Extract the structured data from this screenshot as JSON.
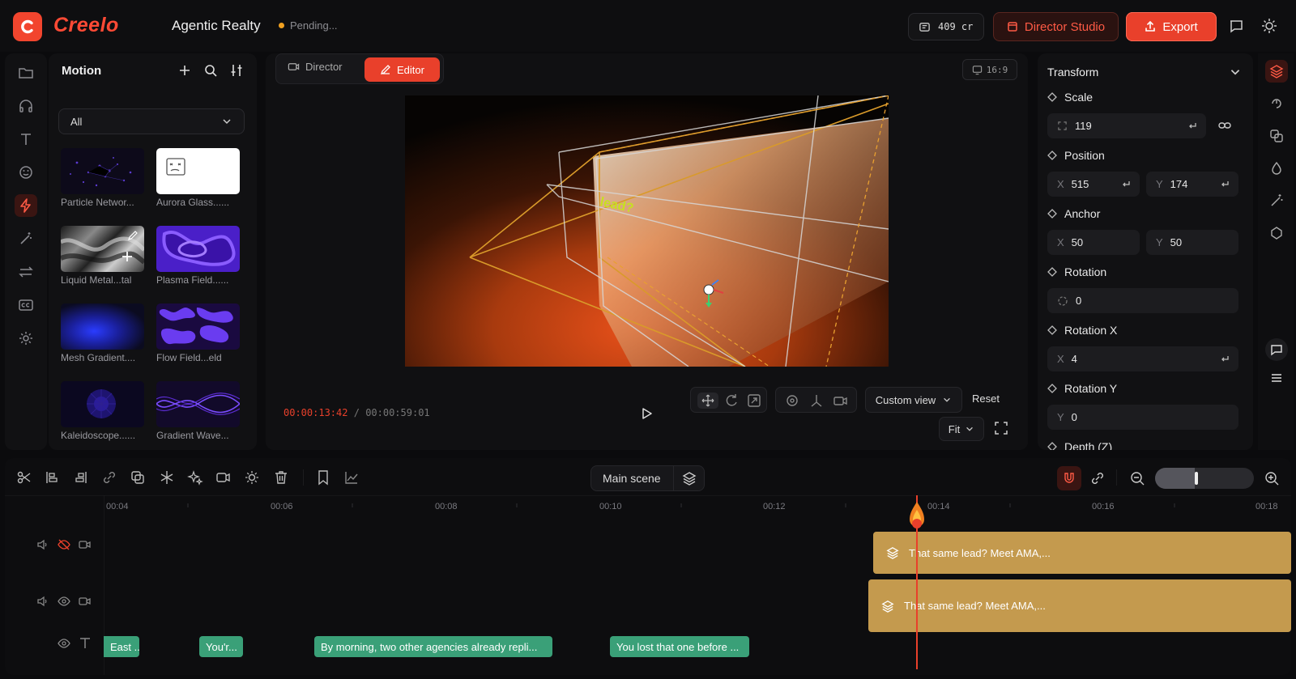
{
  "app": {
    "name": "Creelo",
    "project_name": "Agentic Realty",
    "status": "Pending..."
  },
  "header": {
    "credits": "409 cr",
    "director_studio_label": "Director Studio",
    "export_label": "Export"
  },
  "motion_panel": {
    "title": "Motion",
    "filter_value": "All",
    "items": [
      {
        "label": "Particle Networ..."
      },
      {
        "label": "Aurora Glass......"
      },
      {
        "label": "Liquid Metal...tal"
      },
      {
        "label": "Plasma Field......"
      },
      {
        "label": "Mesh Gradient...."
      },
      {
        "label": "Flow Field...eld"
      },
      {
        "label": "Kaleidoscope......"
      },
      {
        "label": "Gradient Wave..."
      }
    ]
  },
  "editor": {
    "mode_tabs": [
      {
        "label": "Director"
      },
      {
        "label": "Editor"
      }
    ],
    "aspect_ratio": "16:9",
    "canvas_text": "lead?",
    "current_time": "00:00:13:42",
    "separator": "/",
    "total_time": "00:00:59:01",
    "view_mode": "Custom view",
    "reset_label": "Reset",
    "fit_label": "Fit"
  },
  "transform": {
    "title": "Transform",
    "scale_label": "Scale",
    "scale": "119",
    "position_label": "Position",
    "position_x": "515",
    "position_y": "174",
    "anchor_label": "Anchor",
    "anchor_x": "50",
    "anchor_y": "50",
    "rotation_label": "Rotation",
    "rotation": "0",
    "rotation_x_label": "Rotation X",
    "rotation_x": "4",
    "rotation_y_label": "Rotation Y",
    "rotation_y": "0",
    "depth_label": "Depth (Z)",
    "axis_x": "X",
    "axis_y": "Y"
  },
  "timeline": {
    "scene_label": "Main scene",
    "ruler": [
      "00:04",
      "00:06",
      "00:08",
      "00:10",
      "00:12",
      "00:14",
      "00:16",
      "00:18"
    ],
    "playhead_time_seconds": 13.7,
    "tracks": [
      {
        "clips": [
          {
            "label": "That same lead? Meet AMA,..."
          }
        ]
      },
      {
        "clips": [
          {
            "label": "That same lead? Meet AMA,..."
          }
        ]
      },
      {
        "clips": [
          {
            "label": "East ..."
          },
          {
            "label": "You'r..."
          },
          {
            "label": "By morning, two other agencies already repli..."
          },
          {
            "label": "You lost that one before ..."
          }
        ]
      }
    ],
    "zoom_level": 0.4
  },
  "colors": {
    "accent": "#e9402b",
    "clip_gold": "#c49a4e",
    "clip_green": "#3aa078",
    "background": "#0b0b0d"
  }
}
